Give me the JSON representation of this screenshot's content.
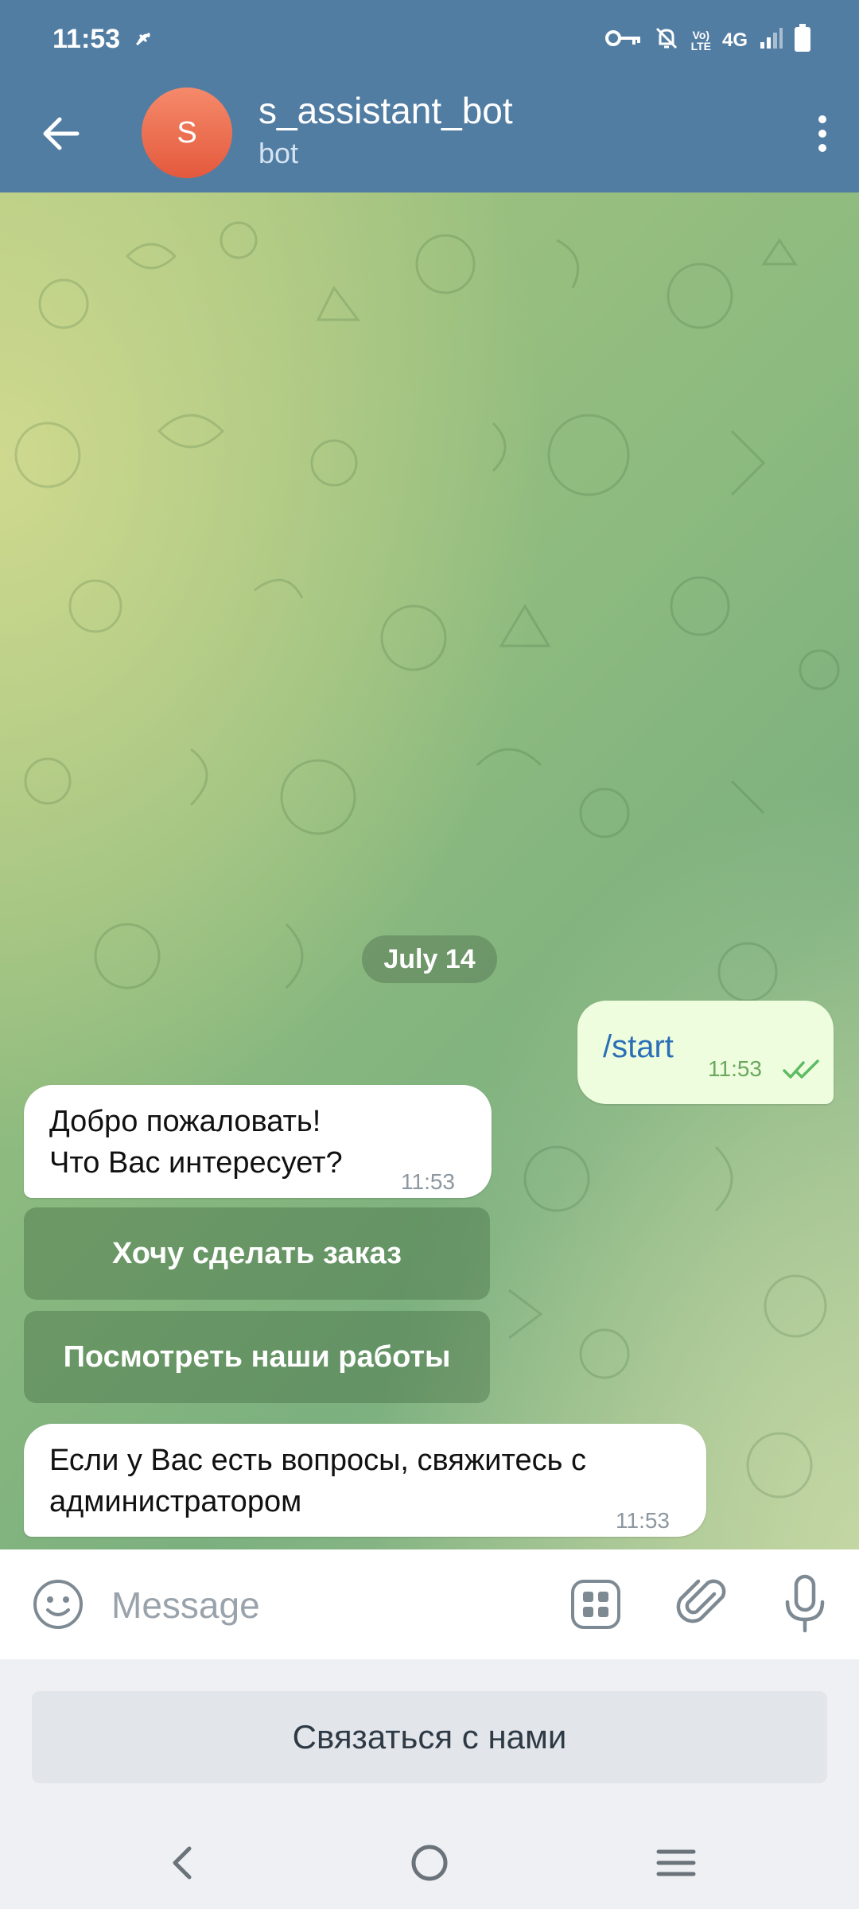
{
  "status_bar": {
    "time": "11:53",
    "network_label": "4G",
    "volte_label_top": "Vo)",
    "volte_label_bottom": "LTE"
  },
  "toolbar": {
    "avatar_letter": "S",
    "title": "s_assistant_bot",
    "subtitle": "bot",
    "accent_color": "#527da3",
    "avatar_color": "#e4593d"
  },
  "chat": {
    "date_label": "July 14",
    "messages": [
      {
        "direction": "outgoing",
        "text": "/start",
        "time": "11:53",
        "status": "read"
      },
      {
        "direction": "incoming",
        "text": "Добро пожаловать!\nЧто Вас интересует?",
        "time": "11:53"
      },
      {
        "direction": "incoming",
        "text": "Если у Вас есть вопросы, свяжитесь с администратором",
        "time": "11:53"
      }
    ],
    "inline_buttons": [
      {
        "label": "Хочу сделать заказ"
      },
      {
        "label": "Посмотреть наши работы"
      }
    ]
  },
  "input": {
    "placeholder": "Message",
    "value": ""
  },
  "reply_keyboard": {
    "buttons": [
      {
        "label": "Связаться с нами"
      }
    ]
  }
}
